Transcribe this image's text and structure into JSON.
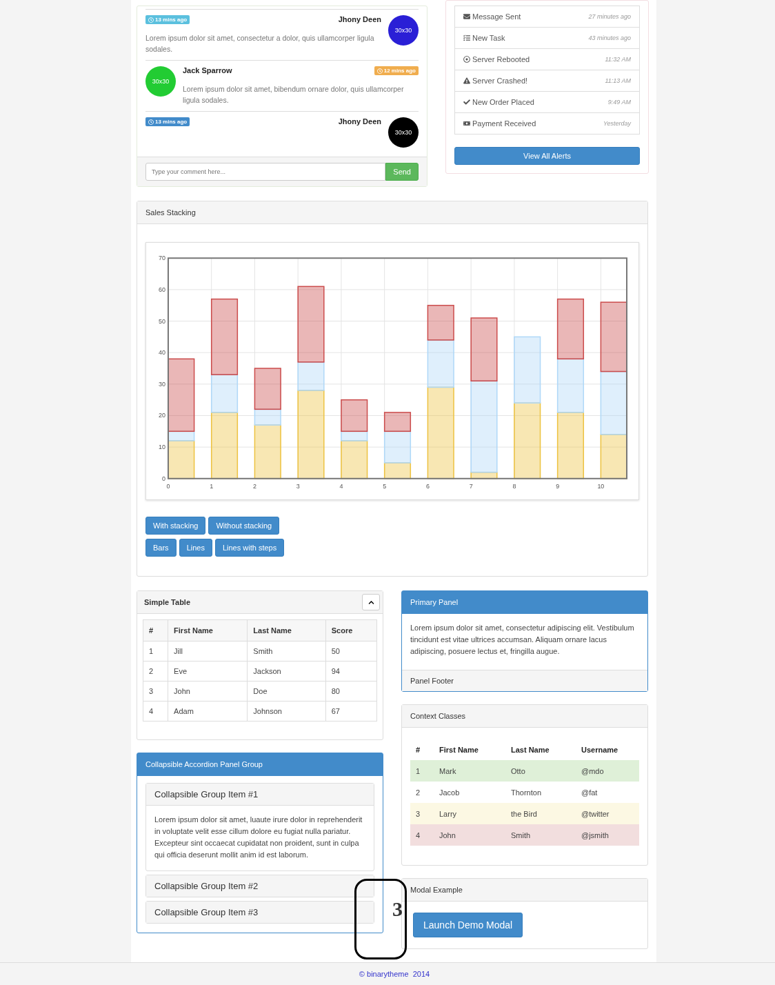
{
  "chat": {
    "messages": [
      {
        "kind": "right",
        "time": {
          "text": "13 mins ago",
          "color": "#5bc0de"
        },
        "author": "Jhony Deen",
        "avatar": {
          "text": "30x30",
          "color": "#2a1fd6"
        },
        "text": "Lorem ipsum dolor sit amet, consectetur a dolor, quis ullamcorper ligula sodales."
      },
      {
        "kind": "left",
        "time": {
          "text": "12 mins ago",
          "color": "#f0ad4e"
        },
        "author": "Jack Sparrow",
        "avatar": {
          "text": "30x30",
          "color": "#22cc33"
        },
        "text": "Lorem ipsum dolor sit amet, bibendum ornare dolor, quis ullamcorper ligula sodales."
      },
      {
        "kind": "right",
        "time": {
          "text": "13 mins ago",
          "color": "#428bca"
        },
        "author": "Jhony Deen",
        "avatar": {
          "text": "30x30",
          "color": "#000000"
        }
      }
    ],
    "input": {
      "placeholder": "Type your comment here..."
    },
    "send": "Send"
  },
  "alerts": {
    "items": [
      {
        "label": "Message Sent",
        "time": "27 minutes ago"
      },
      {
        "label": "New Task",
        "time": "43 minutes ago"
      },
      {
        "label": "Server Rebooted",
        "time": "11:32 AM"
      },
      {
        "label": "Server Crashed!",
        "time": "11:13 AM"
      },
      {
        "label": "New Order Placed",
        "time": "9:49 AM"
      },
      {
        "label": "Payment Received",
        "time": "Yesterday"
      }
    ],
    "button": "View All Alerts"
  },
  "sales": {
    "title": "Sales Stacking",
    "chart_data": {
      "type": "bar",
      "stacked": true,
      "x": [
        0.3,
        1.3,
        2.3,
        3.3,
        4.3,
        5.3,
        6.3,
        7.3,
        8.3,
        9.3,
        10.3
      ],
      "grid": true,
      "xlim": [
        0,
        10.6
      ],
      "ylim": [
        0,
        70
      ],
      "xticks": [
        0,
        1,
        2,
        3,
        4,
        5,
        6,
        7,
        8,
        9,
        10
      ],
      "yticks": [
        0,
        10,
        20,
        30,
        40,
        50,
        60,
        70
      ],
      "series": [
        {
          "color": "#edc240",
          "values": [
            12,
            21,
            17,
            28,
            12,
            5,
            29,
            2,
            24,
            21,
            14
          ]
        },
        {
          "color": "#afd8f8",
          "values": [
            3,
            12,
            5,
            9,
            3,
            10,
            15,
            29,
            21,
            17,
            20
          ]
        },
        {
          "color": "#cb4b4b",
          "values": [
            23,
            24,
            13,
            24,
            10,
            6,
            11,
            20,
            0,
            19,
            22
          ]
        }
      ]
    },
    "button_rows": [
      [
        "With stacking",
        "Without stacking"
      ],
      [
        "Bars",
        "Lines",
        "Lines with steps"
      ]
    ]
  },
  "simple_table": {
    "title": "Simple Table",
    "columns": [
      "#",
      "First Name",
      "Last Name",
      "Score"
    ],
    "rows": [
      [
        "1",
        "Jill",
        "Smith",
        "50"
      ],
      [
        "2",
        "Eve",
        "Jackson",
        "94"
      ],
      [
        "3",
        "John",
        "Doe",
        "80"
      ],
      [
        "4",
        "Adam",
        "Johnson",
        "67"
      ]
    ]
  },
  "primary_panel": {
    "title": "Primary Panel",
    "body": "Lorem ipsum dolor sit amet, consectetur adipiscing elit. Vestibulum tincidunt est vitae ultrices accumsan. Aliquam ornare lacus adipiscing, posuere lectus et, fringilla augue.",
    "footer": "Panel Footer"
  },
  "context_table": {
    "title": "Context Classes",
    "columns": [
      "#",
      "First Name",
      "Last Name",
      "Username"
    ],
    "rows": [
      {
        "color": "#dff0d8",
        "cells": [
          "1",
          "Mark",
          "Otto",
          "@mdo"
        ]
      },
      {
        "color": "#ffffff",
        "cells": [
          "2",
          "Jacob",
          "Thornton",
          "@fat"
        ]
      },
      {
        "color": "#fcf8e3",
        "cells": [
          "3",
          "Larry",
          "the Bird",
          "@twitter"
        ]
      },
      {
        "color": "#f2dede",
        "cells": [
          "4",
          "John",
          "Smith",
          "@jsmith"
        ]
      }
    ]
  },
  "accordion": {
    "title": "Collapsible Accordion Panel Group",
    "items": [
      {
        "title": "Collapsible Group Item #1",
        "expanded": true,
        "body": "Lorem ipsum dolor sit amet, luaute irure dolor in reprehenderit in voluptate velit esse cillum dolore eu fugiat nulla pariatur. Excepteur sint occaecat cupidatat non proident, sunt in culpa qui officia deserunt mollit anim id est laborum."
      },
      {
        "title": "Collapsible Group Item #2",
        "expanded": false
      },
      {
        "title": "Collapsible Group Item #3",
        "expanded": false
      }
    ]
  },
  "modal": {
    "title": "Modal Example",
    "button": "Launch Demo Modal"
  },
  "callout": {
    "label": "3"
  },
  "footer": {
    "text": "© binarytheme  2014"
  }
}
